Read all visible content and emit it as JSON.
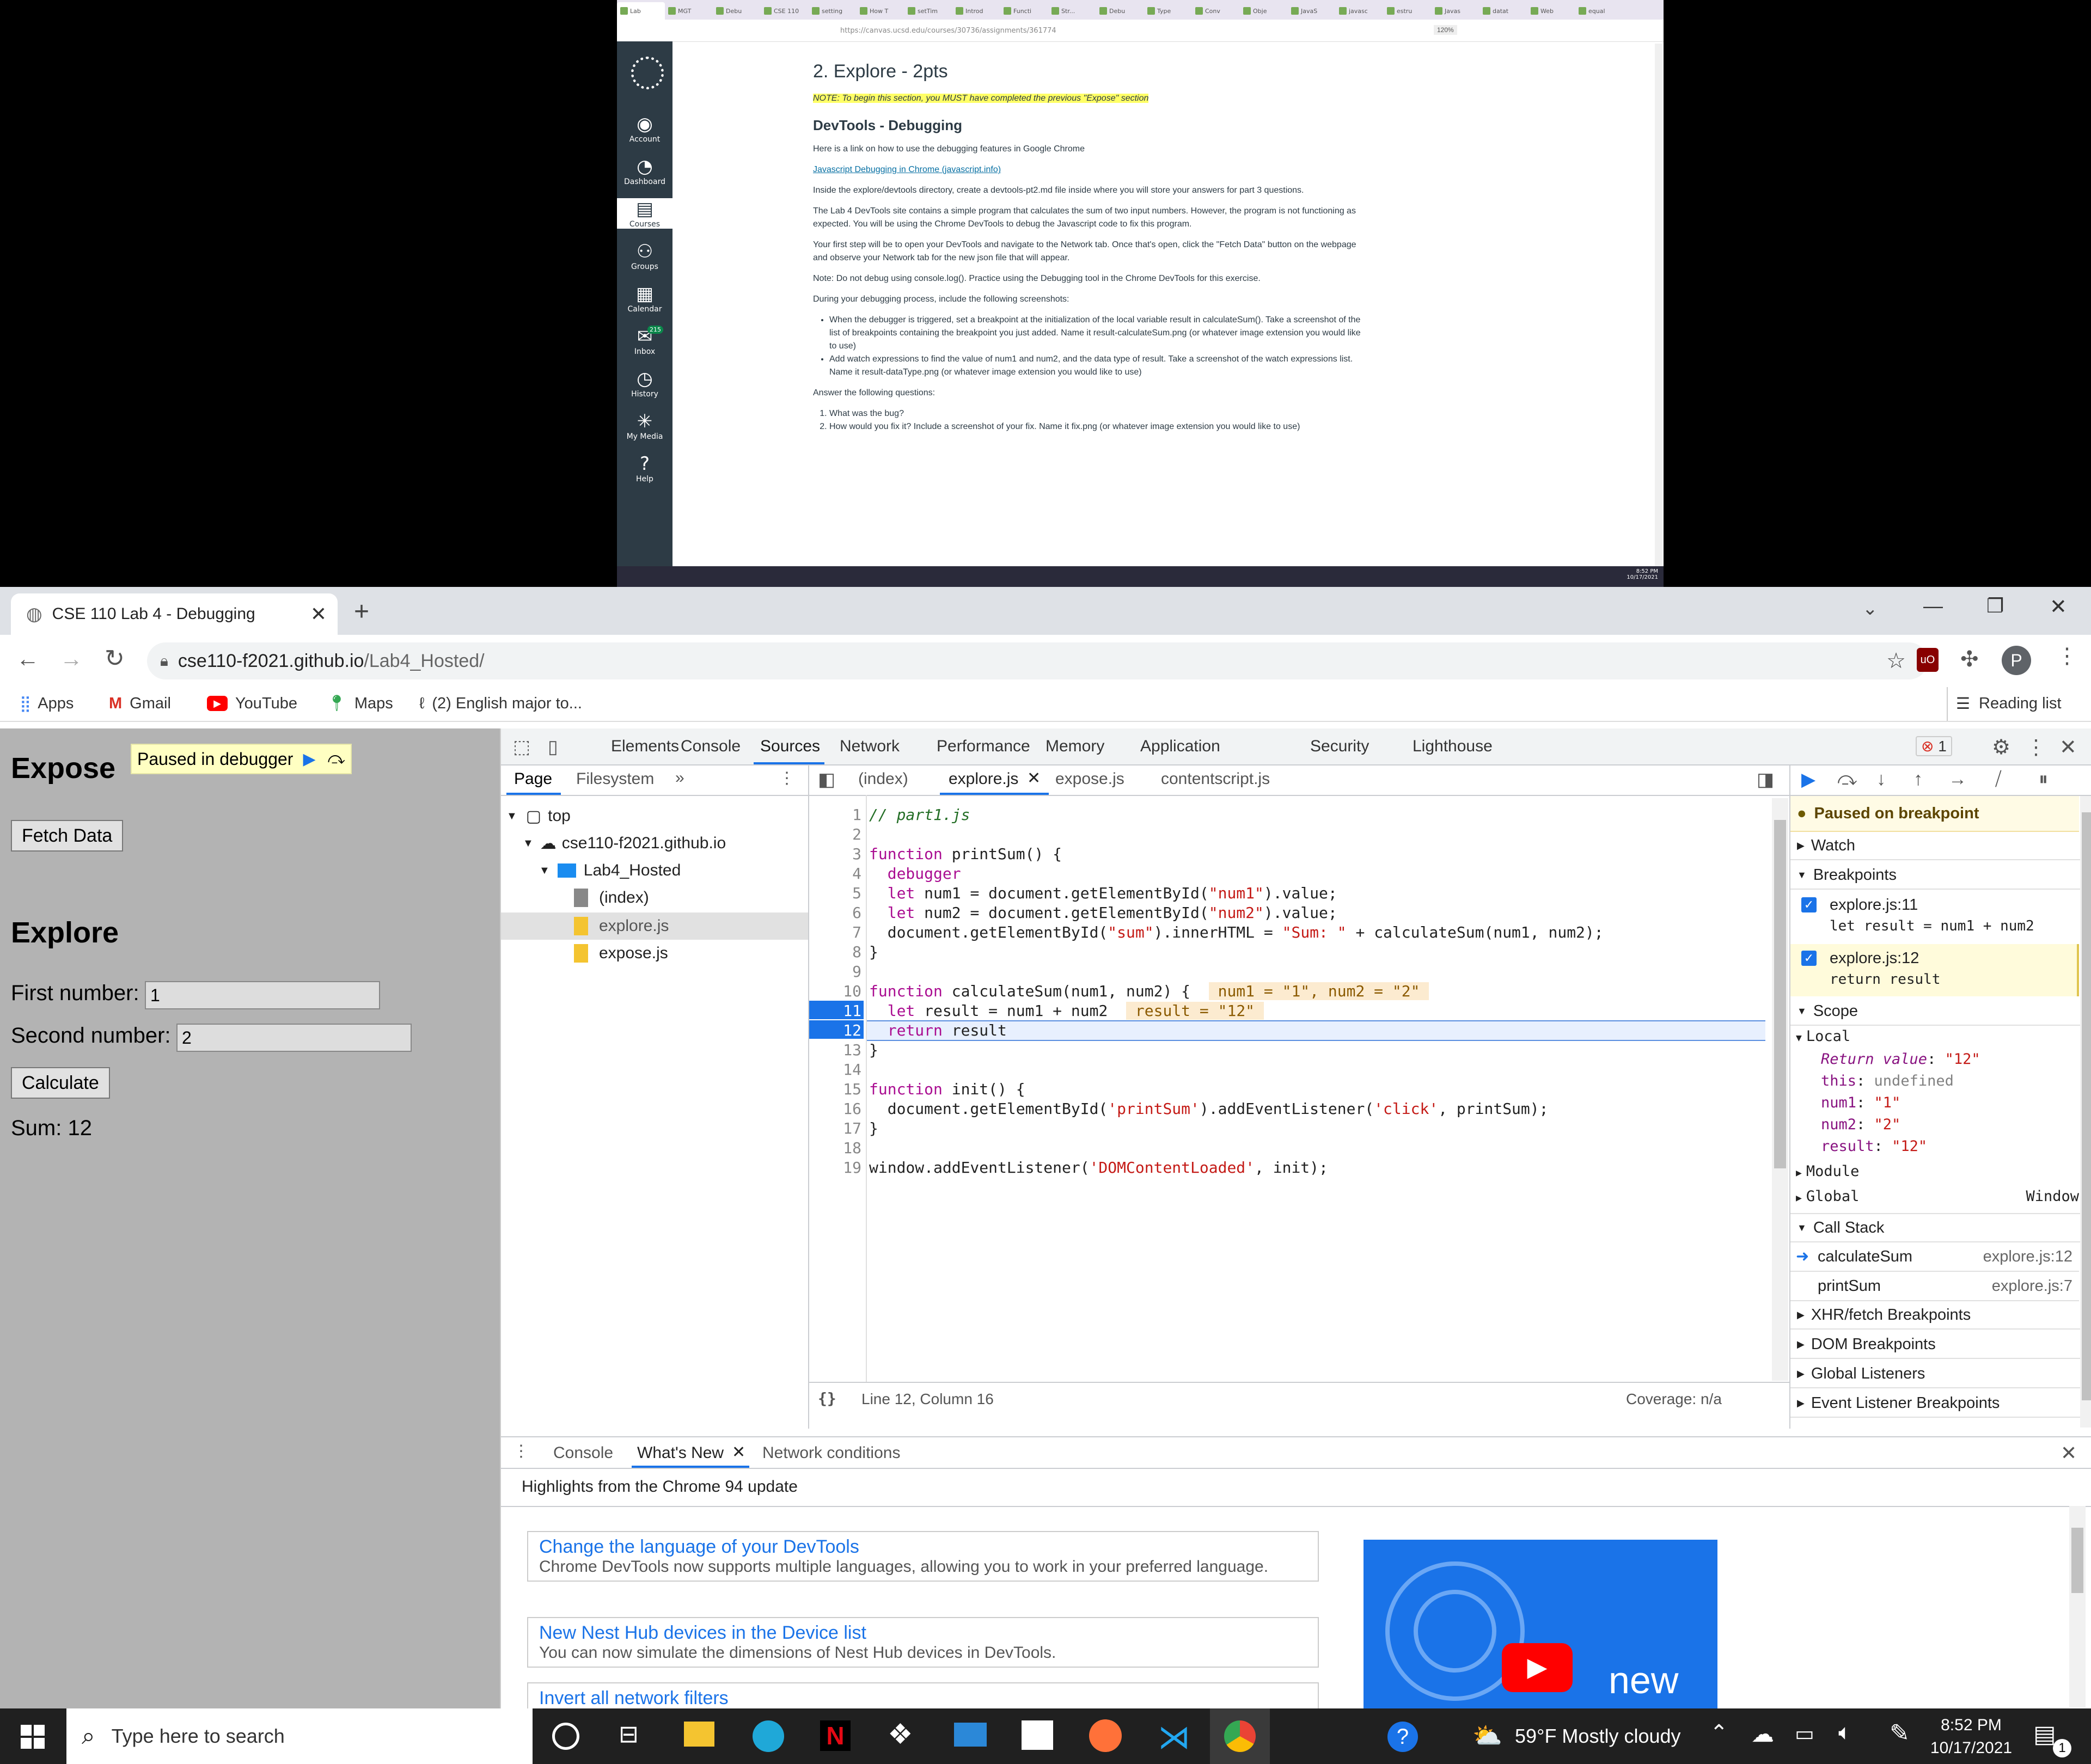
{
  "top_browser": {
    "tabs": [
      "Lab",
      "MGT",
      "Debu",
      "CSE 110",
      "setting",
      "How T",
      "setTim",
      "Introd",
      "Functi",
      "Str...",
      "Debu",
      "Type",
      "Conv",
      "Obje",
      "JavaS",
      "javasc",
      "estru",
      "Javas",
      "datat",
      "Web",
      "equal"
    ],
    "url": "https://canvas.ucsd.edu/courses/30736/assignments/361774",
    "zoom": "120%",
    "nav": [
      {
        "label": "Account",
        "icon": "account-icon"
      },
      {
        "label": "Dashboard",
        "icon": "dashboard-icon"
      },
      {
        "label": "Courses",
        "icon": "courses-icon"
      },
      {
        "label": "Groups",
        "icon": "groups-icon"
      },
      {
        "label": "Calendar",
        "icon": "calendar-icon"
      },
      {
        "label": "Inbox",
        "icon": "inbox-icon",
        "badge": "215"
      },
      {
        "label": "History",
        "icon": "history-icon"
      },
      {
        "label": "My Media",
        "icon": "media-icon"
      },
      {
        "label": "Help",
        "icon": "help-icon"
      }
    ],
    "content": {
      "title": "2. Explore - 2pts",
      "note": "NOTE: To begin this section, you MUST have completed the previous \"Expose\" section",
      "subtitle": "DevTools - Debugging",
      "p1": "Here is a link on how to use the debugging features in Google Chrome",
      "link1": "Javascript Debugging in Chrome (javascript.info)",
      "p2": "Inside the explore/devtools directory, create a devtools-pt2.md file inside where you will store your answers for part 3 questions.",
      "p3": "The Lab 4 DevTools site contains a simple program that calculates the sum of two input numbers. However, the program is not functioning as expected. You will be using the Chrome DevTools to debug the Javascript code to fix this program.",
      "p4": "Your first step will be to open your DevTools and navigate to the Network tab. Once that's open, click the \"Fetch Data\" button on the webpage and observe your Network tab for the new json file that will appear.",
      "p5": "Note: Do not debug using console.log(). Practice using the Debugging tool in the Chrome DevTools for this exercise.",
      "p6": "During your debugging process, include the following screenshots:",
      "bullet1": "When the debugger is triggered, set a breakpoint at the initialization of the local variable result in calculateSum(). Take a screenshot of the list of breakpoints containing the breakpoint you just added. Name it result-calculateSum.png (or whatever image extension you would like to use)",
      "bullet2": "Add watch expressions to find the value of num1 and num2, and the data type of result. Take a screenshot of the watch expressions list. Name it result-dataType.png (or whatever image extension you would like to use)",
      "p7": "Answer the following questions:",
      "q1": "What was the bug?",
      "q2": "How would you fix it? Include a screenshot of your fix. Name it fix.png (or whatever image extension you would like to use)"
    },
    "clock": {
      "time": "8:52 PM",
      "date": "10/17/2021"
    }
  },
  "chrome": {
    "tab_title": "CSE 110 Lab 4 - Debugging",
    "url_host": "cse110-f2021.github.io",
    "url_path": "/Lab4_Hosted/",
    "profile_letter": "P",
    "bookmarks": [
      "Apps",
      "Gmail",
      "YouTube",
      "Maps",
      "(2) English major to..."
    ],
    "reading_list": "Reading list"
  },
  "page": {
    "expose_heading": "Expose",
    "paused_label": "Paused in debugger",
    "fetch_button": "Fetch Data",
    "explore_heading": "Explore",
    "first_label": "First number:",
    "first_value": "1",
    "second_label": "Second number:",
    "second_value": "2",
    "calculate_button": "Calculate",
    "sum_text": "Sum: 12"
  },
  "devtools": {
    "tabs": [
      "Elements",
      "Console",
      "Sources",
      "Network",
      "Performance",
      "Memory",
      "Application",
      "Security",
      "Lighthouse"
    ],
    "active_tab": "Sources",
    "error_count": "1",
    "nav_tabs": [
      "Page",
      "Filesystem"
    ],
    "tree": [
      "top",
      "cse110-f2021.github.io",
      "Lab4_Hosted",
      "(index)",
      "explore.js",
      "expose.js"
    ],
    "file_tabs": [
      "(index)",
      "explore.js",
      "expose.js",
      "contentscript.js"
    ],
    "code_lines": [
      "// part1.js",
      "",
      "function printSum() {",
      "  debugger",
      "  let num1 = document.getElementById(\"num1\").value;",
      "  let num2 = document.getElementById(\"num2\").value;",
      "  document.getElementById(\"sum\").innerHTML = \"Sum: \" + calculateSum(num1, num2);",
      "}",
      "",
      "function calculateSum(num1, num2) {",
      "  let result = num1 + num2",
      "  return result",
      "}",
      "",
      "function init() {",
      "  document.getElementById('printSum').addEventListener('click', printSum);",
      "}",
      "",
      "window.addEventListener('DOMContentLoaded', init);"
    ],
    "inline_values": {
      "line10": "num1 = \"1\", num2 = \"2\"",
      "line11": "result = \"12\""
    },
    "status_position": "Line 12, Column 16",
    "status_coverage": "Coverage: n/a",
    "paused_title": "Paused on breakpoint",
    "watch": "Watch",
    "breakpoints_title": "Breakpoints",
    "breakpoints": [
      {
        "file": "explore.js:11",
        "code": "let result = num1 + num2"
      },
      {
        "file": "explore.js:12",
        "code": "return result"
      }
    ],
    "scope_title": "Scope",
    "local_title": "Local",
    "scope_local": [
      {
        "name": "Return value",
        "value": "\"12\""
      },
      {
        "name": "this",
        "value": "undefined"
      },
      {
        "name": "num1",
        "value": "\"1\""
      },
      {
        "name": "num2",
        "value": "\"2\""
      },
      {
        "name": "result",
        "value": "\"12\""
      }
    ],
    "module": "Module",
    "global": "Global",
    "global_value": "Window",
    "callstack_title": "Call Stack",
    "callstack": [
      {
        "fn": "calculateSum",
        "loc": "explore.js:12"
      },
      {
        "fn": "printSum",
        "loc": "explore.js:7"
      }
    ],
    "more_sections": [
      "XHR/fetch Breakpoints",
      "DOM Breakpoints",
      "Global Listeners",
      "Event Listener Breakpoints"
    ],
    "drawer_tabs": [
      "Console",
      "What's New",
      "Network conditions"
    ],
    "drawer_heading": "Highlights from the Chrome 94 update",
    "cards": [
      {
        "title": "Change the language of your DevTools",
        "desc": "Chrome DevTools now supports multiple languages, allowing you to work in your preferred language."
      },
      {
        "title": "New Nest Hub devices in the Device list",
        "desc": "You can now simulate the dimensions of Nest Hub devices in DevTools."
      },
      {
        "title": "Invert all network filters",
        "desc": ""
      }
    ],
    "video_text": "new"
  },
  "taskbar": {
    "search_placeholder": "Type here to search",
    "weather": "59°F  Mostly cloudy",
    "time": "8:52 PM",
    "date": "10/17/2021",
    "notification_count": "1"
  }
}
